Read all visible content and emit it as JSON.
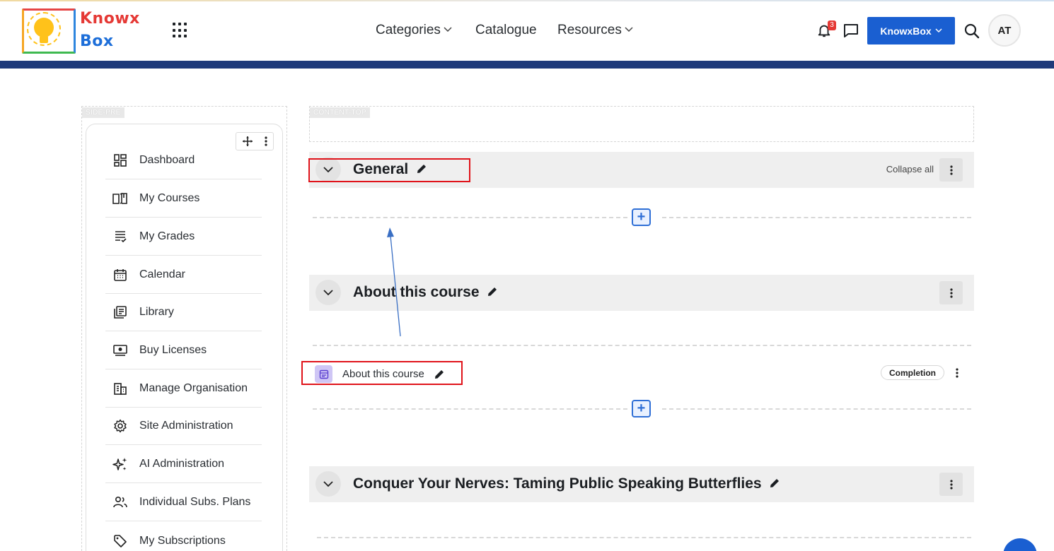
{
  "brand": {
    "logo_line1": "Knowx",
    "logo_line2": "Box"
  },
  "nav": {
    "categories": "Categories",
    "catalogue": "Catalogue",
    "resources": "Resources"
  },
  "header": {
    "notification_count": "3",
    "workspace_button": "KnowxBox",
    "avatar_initials": "AT"
  },
  "regions": {
    "side_pre": "SIDE-PRE",
    "content_top": "CONTENT-TOP"
  },
  "sidebar": {
    "items": [
      {
        "label": "Dashboard",
        "icon": "dashboard-icon"
      },
      {
        "label": "My Courses",
        "icon": "book-open-icon"
      },
      {
        "label": "My Grades",
        "icon": "grades-list-icon"
      },
      {
        "label": "Calendar",
        "icon": "calendar-icon"
      },
      {
        "label": "Library",
        "icon": "library-icon"
      },
      {
        "label": "Buy Licenses",
        "icon": "license-icon"
      },
      {
        "label": "Manage Organisation",
        "icon": "organisation-icon"
      },
      {
        "label": "Site Administration",
        "icon": "gear-icon"
      },
      {
        "label": "AI Administration",
        "icon": "sparkle-icon"
      },
      {
        "label": "Individual Subs. Plans",
        "icon": "users-icon"
      },
      {
        "label": "My Subscriptions",
        "icon": "tag-icon"
      }
    ]
  },
  "course": {
    "collapse_all": "Collapse all",
    "sections": [
      {
        "title": "General"
      },
      {
        "title": "About this course"
      },
      {
        "title": "Conquer Your Nerves: Taming Public Speaking Butterflies"
      }
    ],
    "activity": {
      "label": "About this course",
      "completion_badge": "Completion"
    }
  },
  "colors": {
    "brand_blue": "#1a5fd1",
    "header_bar": "#1e3a7a",
    "highlight_red": "#e0131a"
  }
}
